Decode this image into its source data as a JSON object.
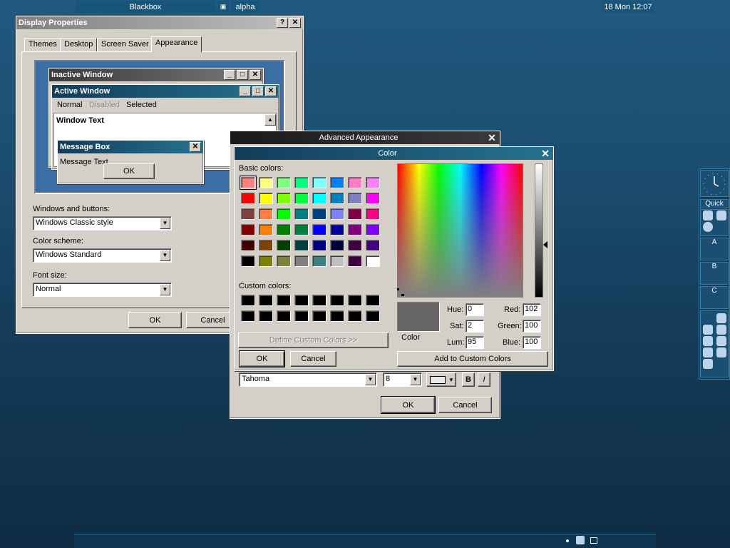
{
  "display_properties": {
    "title": "Display Properties",
    "tabs": [
      "Themes",
      "Desktop",
      "Screen Saver",
      "Appearance"
    ],
    "preview": {
      "inactive_title": "Inactive Window",
      "active_title": "Active Window",
      "menu": [
        "Normal",
        "Disabled",
        "Selected"
      ],
      "window_text": "Window Text",
      "msgbox_title": "Message Box",
      "msgbox_text": "Message Text",
      "msgbox_ok": "OK"
    },
    "windows_buttons_label": "Windows and buttons:",
    "windows_buttons_value": "Windows Classic style",
    "color_scheme_label": "Color scheme:",
    "color_scheme_value": "Windows Standard",
    "font_size_label": "Font size:",
    "font_size_value": "Normal",
    "ok": "OK",
    "cancel": "Cancel"
  },
  "advanced": {
    "title": "Advanced Appearance",
    "font_value": "Tahoma",
    "size_value": "8",
    "bold": "B",
    "italic": "I",
    "ok": "OK",
    "cancel": "Cancel"
  },
  "color_dialog": {
    "title": "Color",
    "basic_label": "Basic colors:",
    "custom_label": "Custom colors:",
    "define_button": "Define Custom Colors >>",
    "ok": "OK",
    "cancel": "Cancel",
    "color_label": "Color",
    "hue_label": "Hue:",
    "hue": "0",
    "sat_label": "Sat:",
    "sat": "2",
    "lum_label": "Lum:",
    "lum": "95",
    "red_label": "Red:",
    "red": "102",
    "green_label": "Green:",
    "green": "100",
    "blue_label": "Blue:",
    "blue": "100",
    "add_button": "Add to Custom Colors",
    "preview_color": "#666464",
    "basic_colors": [
      [
        "#ff8080",
        "#ffff80",
        "#80ff80",
        "#00ff80",
        "#80ffff",
        "#0080ff",
        "#ff80c0",
        "#ff80ff"
      ],
      [
        "#ff0000",
        "#ffff00",
        "#80ff00",
        "#00ff40",
        "#00ffff",
        "#0080c0",
        "#8080c0",
        "#ff00ff"
      ],
      [
        "#804040",
        "#ff8040",
        "#00ff00",
        "#008080",
        "#004080",
        "#8080ff",
        "#800040",
        "#ff0080"
      ],
      [
        "#800000",
        "#ff8000",
        "#008000",
        "#008040",
        "#0000ff",
        "#0000a0",
        "#800080",
        "#8000ff"
      ],
      [
        "#400000",
        "#804000",
        "#004000",
        "#004040",
        "#000080",
        "#000040",
        "#400040",
        "#400080"
      ],
      [
        "#000000",
        "#808000",
        "#808040",
        "#808080",
        "#408080",
        "#c0c0c0",
        "#400040",
        "#ffffff"
      ]
    ],
    "custom_colors": [
      [
        "#000000",
        "#000000",
        "#000000",
        "#000000",
        "#000000",
        "#000000",
        "#000000",
        "#000000"
      ],
      [
        "#000000",
        "#000000",
        "#000000",
        "#000000",
        "#000000",
        "#000000",
        "#000000",
        "#000000"
      ]
    ]
  },
  "dock": {
    "quick_label": "Quick",
    "a_label": "A",
    "b_label": "B",
    "c_label": "C"
  },
  "taskbar": {
    "blackbox": "Blackbox",
    "workspace": "alpha",
    "clock": "18 Mon 12:07"
  }
}
